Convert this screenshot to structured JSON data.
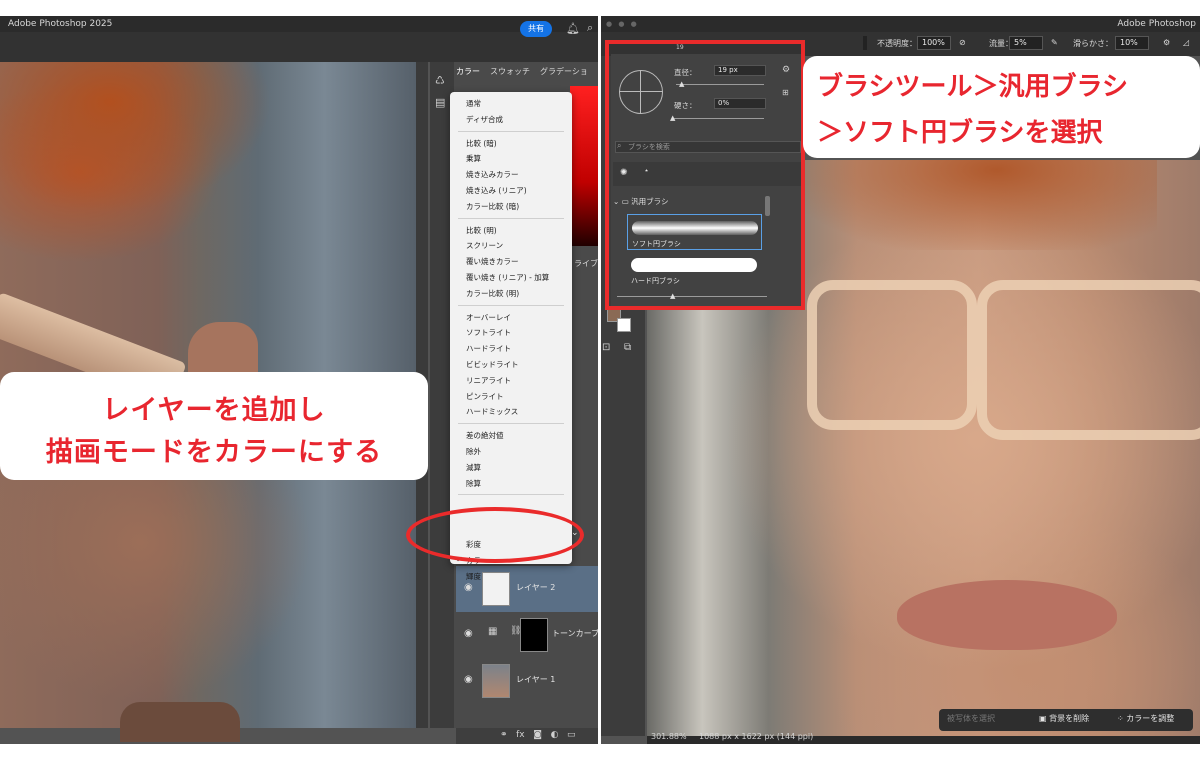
{
  "left": {
    "app_title": "Adobe Photoshop 2025",
    "share_label": "共有",
    "panel_tabs": [
      "カラー",
      "スウォッチ",
      "グラデーショ"
    ],
    "partial_tab": "ライブ",
    "blend_groups": [
      [
        "通常",
        "ディザ合成"
      ],
      [
        "比較 (暗)",
        "乗算",
        "焼き込みカラー",
        "焼き込み (リニア)",
        "カラー比較 (暗)"
      ],
      [
        "比較 (明)",
        "スクリーン",
        "覆い焼きカラー",
        "覆い焼き (リニア) - 加算",
        "カラー比較 (明)"
      ],
      [
        "オーバーレイ",
        "ソフトライト",
        "ハードライト",
        "ビビッドライト",
        "リニアライト",
        "ピンライト",
        "ハードミックス"
      ],
      [
        "差の絶対値",
        "除外",
        "減算",
        "除算"
      ],
      [
        "彩度",
        "カラー",
        "輝度"
      ]
    ],
    "selected_blend": "カラー",
    "layers": [
      "レイヤー 2",
      "トーンカーブ",
      "レイヤー 1"
    ],
    "callout_line1": "レイヤーを追加し",
    "callout_line2": "描画モードをカラーにする",
    "accent_red": "#e8262f"
  },
  "right": {
    "app_title": "Adobe Photoshop",
    "options": {
      "opacity_label": "不透明度：",
      "opacity_value": "100%",
      "flow_label": "流量：",
      "flow_value": "5%",
      "smoothing_label": "滑らかさ：",
      "smoothing_value": "10%",
      "brush_size_small": "19"
    },
    "brush_panel": {
      "size_label": "直径：",
      "size_value": "19 px",
      "hardness_label": "硬さ：",
      "hardness_value": "0%",
      "search_placeholder": "ブラシを検索",
      "folder_name": "汎用ブラシ",
      "brushes": [
        "ソフト円ブラシ",
        "ハード円ブラシ"
      ]
    },
    "callout_line1": "ブラシツール＞汎用ブラシ",
    "callout_line2": "＞ソフト円ブラシを選択",
    "status_zoom": "301.88%",
    "status_doc": "1088 px x 1622 px (144 ppi)",
    "context_bar": {
      "b1": "被写体を選択",
      "b2": "背景を削除",
      "b3": "カラーを調整"
    }
  }
}
